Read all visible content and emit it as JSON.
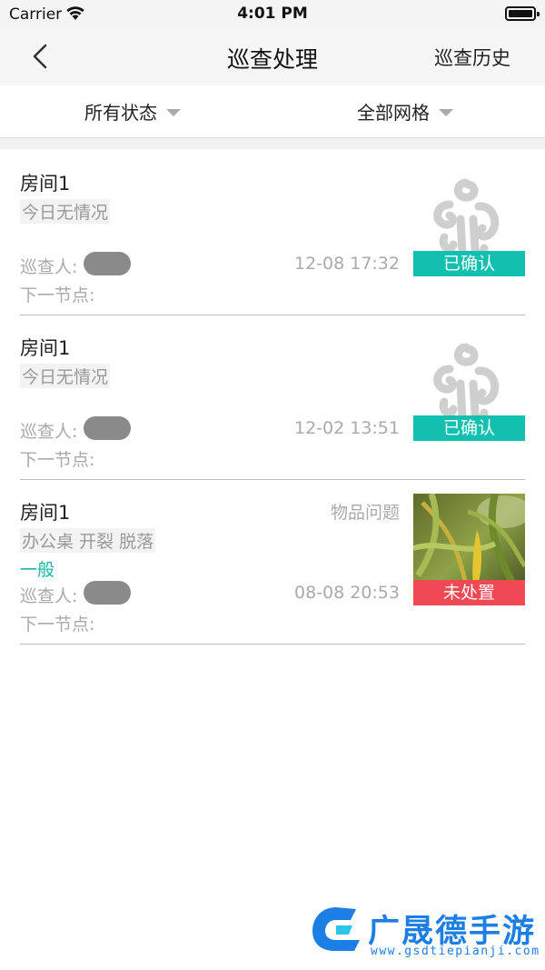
{
  "status_bar": {
    "carrier": "Carrier",
    "time": "4:01 PM",
    "wifi_icon": "wifi-icon",
    "battery_icon": "battery-icon"
  },
  "nav": {
    "title": "巡查处理",
    "right_label": "巡查历史",
    "back_icon": "chevron-left-icon"
  },
  "filters": {
    "status_label": "所有状态",
    "grid_label": "全部网格",
    "caret_icon": "triangle-down-icon"
  },
  "colors": {
    "confirmed_badge": "#13bfae",
    "unhandled_badge": "#ef4a53",
    "level_text": "#19b6a6"
  },
  "records": [
    {
      "title": "房间1",
      "description": "今日无情况",
      "inspector_label": "巡查人:",
      "date": "12-08 17:32",
      "node_label": "下一节点:",
      "status": "已确认",
      "thumbnail": "placeholder-logo-icon"
    },
    {
      "title": "房间1",
      "description": "今日无情况",
      "inspector_label": "巡查人:",
      "date": "12-02 13:51",
      "node_label": "下一节点:",
      "status": "已确认",
      "thumbnail": "placeholder-logo-icon"
    },
    {
      "title": "房间1",
      "category": "物品问题",
      "description": "办公桌 开裂 脱落",
      "level": "一般",
      "inspector_label": "巡查人:",
      "date": "08-08 20:53",
      "node_label": "下一节点:",
      "status": "未处置",
      "thumbnail": "photo-thumbnail"
    }
  ],
  "watermark": {
    "text": "广晟德手游",
    "url": "www.gsdtiepianji.com"
  }
}
